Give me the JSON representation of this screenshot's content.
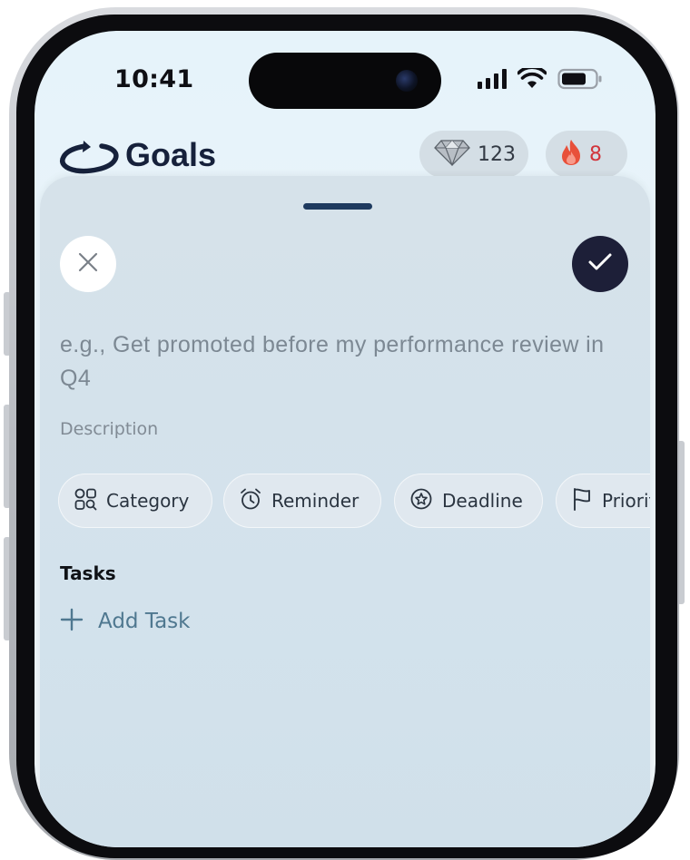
{
  "status_bar": {
    "time": "10:41"
  },
  "header": {
    "title": "Goals",
    "gems": {
      "count": "123",
      "icon": "diamond-icon"
    },
    "streak": {
      "count": "8",
      "icon": "flame-icon"
    }
  },
  "sheet": {
    "goal_placeholder": "e.g., Get promoted before my performance review in Q4",
    "description_label": "Description",
    "chips": [
      {
        "label": "Category",
        "icon": "category-icon"
      },
      {
        "label": "Reminder",
        "icon": "alarm-clock-icon"
      },
      {
        "label": "Deadline",
        "icon": "badge-icon"
      },
      {
        "label": "Priority",
        "icon": "flag-icon"
      }
    ],
    "tasks_label": "Tasks",
    "add_task_label": "Add Task"
  },
  "colors": {
    "brand": "#16213b",
    "confirm": "#1d1f38",
    "streak": "#d2353c",
    "accent": "#4f7890"
  }
}
